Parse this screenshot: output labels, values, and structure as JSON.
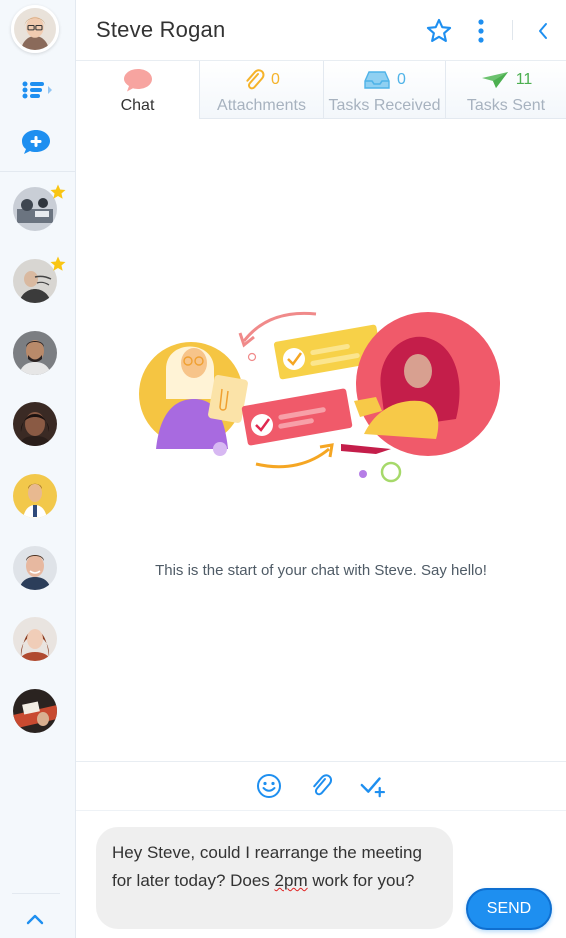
{
  "sidebar": {
    "user_avatar": "current-user-avatar",
    "menu_icon": "task-list-icon",
    "new_chat_icon": "new-chat-icon",
    "contacts": [
      {
        "id": "contact-1",
        "starred": true
      },
      {
        "id": "contact-2",
        "starred": true
      },
      {
        "id": "contact-3",
        "starred": false
      },
      {
        "id": "contact-4",
        "starred": false
      },
      {
        "id": "contact-5",
        "starred": false
      },
      {
        "id": "contact-6",
        "starred": false
      },
      {
        "id": "contact-7",
        "starred": false
      },
      {
        "id": "contact-8",
        "starred": false
      }
    ],
    "collapse_icon": "chevron-up-icon"
  },
  "header": {
    "title": "Steve Rogan",
    "favorite_icon": "star-outline-icon",
    "more_icon": "vertical-dots-icon",
    "back_icon": "chevron-left-icon"
  },
  "tabs": [
    {
      "label": "Chat",
      "icon": "chat-bubble-icon",
      "count": "",
      "active": true
    },
    {
      "label": "Attachments",
      "icon": "paperclip-icon",
      "count": "0",
      "active": false
    },
    {
      "label": "Tasks Received",
      "icon": "inbox-tray-icon",
      "count": "0",
      "active": false
    },
    {
      "label": "Tasks Sent",
      "icon": "paper-plane-icon",
      "count": "11",
      "active": false
    }
  ],
  "chat": {
    "empty_message": "This is the start of your chat with Steve. Say hello!"
  },
  "toolbar": {
    "emoji_icon": "smiley-icon",
    "attach_icon": "paperclip-icon",
    "task_icon": "add-task-icon"
  },
  "composer": {
    "text_before": "Hey Steve, could I rearrange the meeting for later today? Does ",
    "text_misspelled": "2pm",
    "text_after": " work for you?",
    "send_label": "SEND"
  },
  "colors": {
    "accent": "#1e8ff0",
    "attachments": "#f5b32b",
    "tasks_received": "#4fb3e8",
    "tasks_sent": "#4caf50",
    "star": "#f9c513"
  }
}
